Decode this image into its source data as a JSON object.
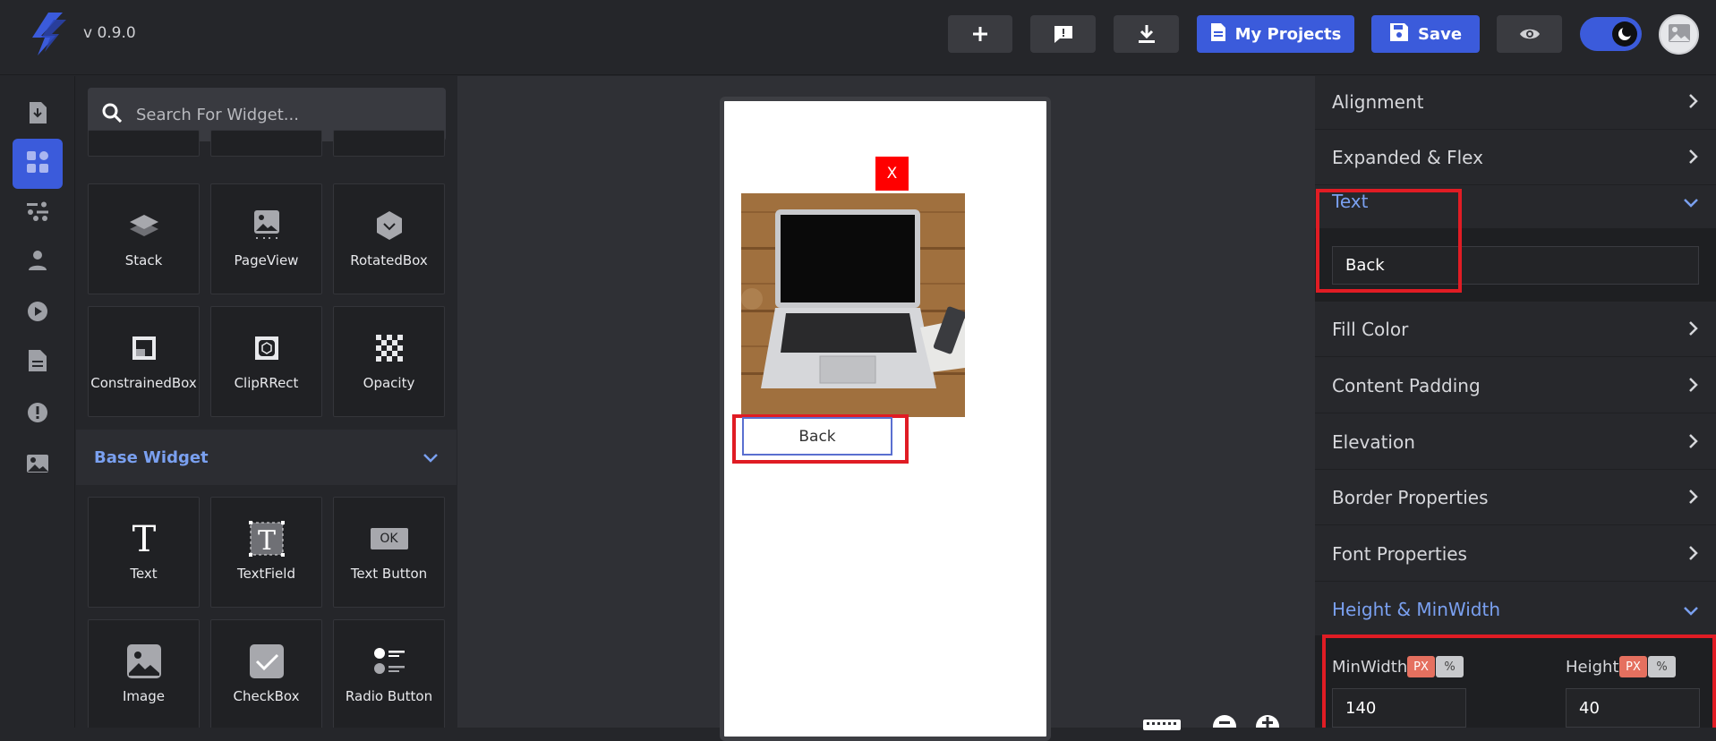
{
  "app": {
    "version": "v 0.9.0"
  },
  "toolbar": {
    "add_icon": "plus-icon",
    "feedback_icon": "feedback-icon",
    "download_icon": "download-icon",
    "my_projects_label": "My Projects",
    "save_label": "Save",
    "preview_icon": "eye-icon",
    "theme_toggle_icon": "moon-icon",
    "accent": "#3b5bdb"
  },
  "rail": [
    "import-icon",
    "widgets-icon",
    "properties-icon",
    "user-icon",
    "play-icon",
    "document-icon",
    "info-icon",
    "image-icon"
  ],
  "search": {
    "placeholder": "Search For Widget..."
  },
  "widgets": {
    "layout": [
      {
        "label": "Stack",
        "icon": "stack-icon"
      },
      {
        "label": "PageView",
        "icon": "pageview-icon"
      },
      {
        "label": "RotatedBox",
        "icon": "rotatedbox-icon"
      },
      {
        "label": "ConstrainedBox",
        "icon": "constrainedbox-icon"
      },
      {
        "label": "ClipRRect",
        "icon": "cliprrect-icon"
      },
      {
        "label": "Opacity",
        "icon": "opacity-icon"
      }
    ],
    "section_title": "Base Widget",
    "base": [
      {
        "label": "Text",
        "icon": "text-icon"
      },
      {
        "label": "TextField",
        "icon": "textfield-icon"
      },
      {
        "label": "Text Button",
        "icon": "text-button-icon",
        "badge": "OK"
      },
      {
        "label": "Image",
        "icon": "image-icon"
      },
      {
        "label": "CheckBox",
        "icon": "checkbox-icon"
      },
      {
        "label": "Radio Button",
        "icon": "radio-button-icon"
      }
    ]
  },
  "canvas": {
    "close_label": "X",
    "back_button_label": "Back",
    "highlight_color": "#e01c24"
  },
  "properties": {
    "rows": [
      "Alignment",
      "Expanded & Flex"
    ],
    "text_section": "Text",
    "text_value": "Back",
    "rows2": [
      "Fill Color",
      "Content Padding",
      "Elevation",
      "Border Properties",
      "Font Properties"
    ],
    "height_section": "Height & MinWidth",
    "minwidth_label": "MinWidth",
    "height_label": "Height",
    "unit_px": "PX",
    "unit_pct": "%",
    "minwidth_value": "140",
    "height_value": "40"
  }
}
